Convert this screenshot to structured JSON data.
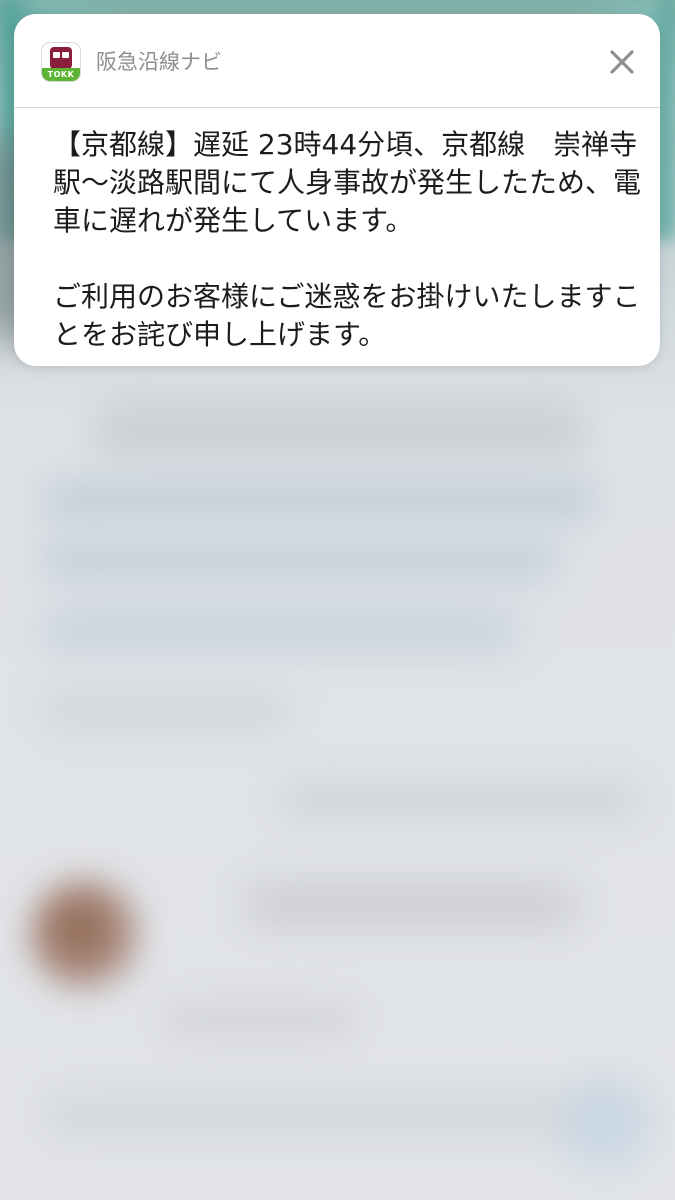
{
  "notification": {
    "app_icon": {
      "icon": "hankyu-train-icon",
      "badge_text": "TOKK",
      "colors": {
        "train": "#8a1c3c",
        "badge": "#5db334"
      }
    },
    "app_name": "阪急沿線ナビ",
    "close_icon": "close-icon",
    "message_paragraph_1": "【京都線】遅延 23時44分頃、京都線　崇禅寺駅〜淡路駅間にて人身事故が発生したため、電車に遅れが発生しています。",
    "message_paragraph_2": "ご利用のお客様にご迷惑をお掛けいたしますことをお詫び申し上げます。"
  }
}
